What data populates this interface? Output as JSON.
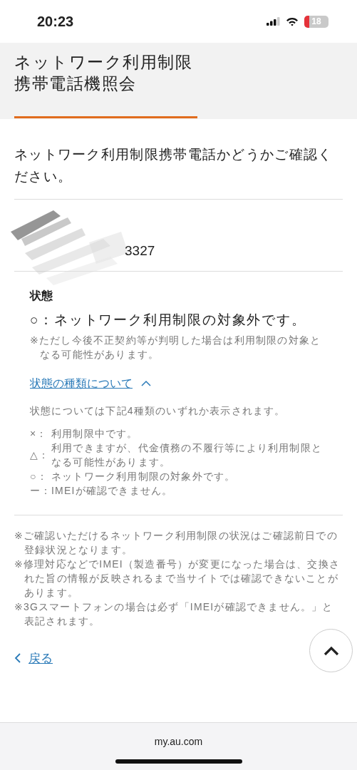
{
  "status_bar": {
    "time": "20:23",
    "battery": "18"
  },
  "header": {
    "title_lines": [
      "ネットワーク利用制限",
      "携帯電話機照会"
    ]
  },
  "intro": "ネットワーク利用制限携帯電話かどうかご確認ください。",
  "imei": {
    "value": "3327"
  },
  "status": {
    "label": "状態",
    "result": "○：ネットワーク利用制限の対象外です。",
    "note": "※ただし今後不正契約等が判明した場合は利用制限の対象となる可能性があります。"
  },
  "types_toggle": {
    "label": "状態の種類について",
    "expanded": true
  },
  "types_intro": "状態については下記4種類のいずれか表示されます。",
  "types": [
    {
      "mark": "×：",
      "text": "利用制限中です。"
    },
    {
      "mark": "△：",
      "text": "利用できますが、代金債務の不履行等により利用制限となる可能性があります。"
    },
    {
      "mark": "○：",
      "text": "ネットワーク利用制限の対象外です。"
    },
    {
      "mark": "ー：",
      "text": "IMEIが確認できません。"
    }
  ],
  "notes": [
    "※ご確認いただけるネットワーク利用制限の状況はご確認前日での登録状況となります。",
    "※修理対応などでIMEI（製造番号）が変更になった場合は、交換された旨の情報が反映されるまで当サイトでは確認できないことがあります。",
    "※3Gスマートフォンの場合は必ず「IMEIが確認できません。」と表記されます。"
  ],
  "back_link": "戻る",
  "browser": {
    "url": "my.au.com"
  }
}
